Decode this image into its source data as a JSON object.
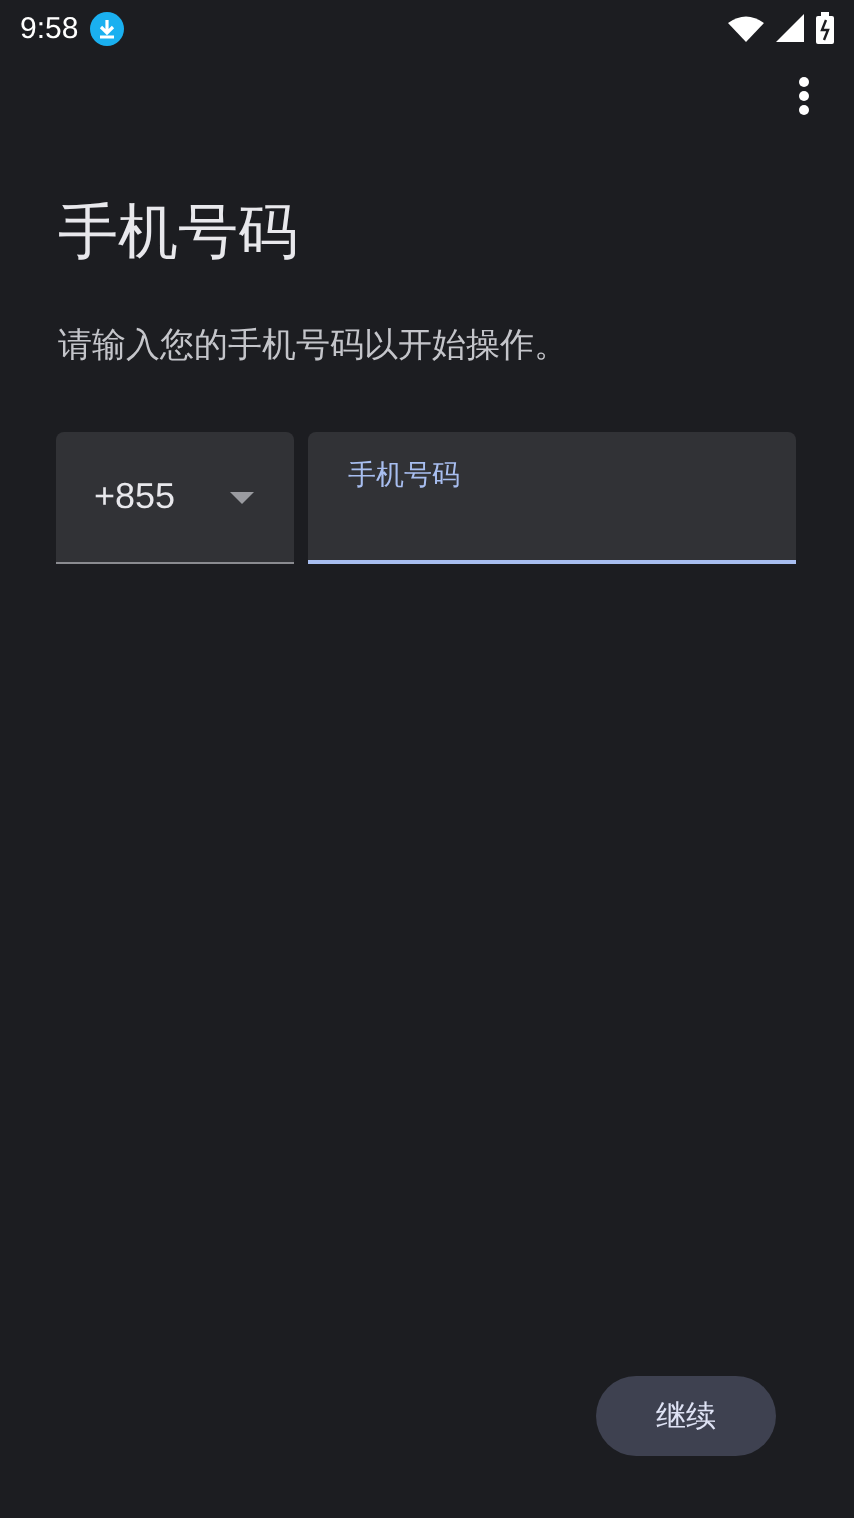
{
  "status_bar": {
    "time": "9:58"
  },
  "title": "手机号码",
  "subtitle": "请输入您的手机号码以开始操作。",
  "country_code": {
    "value": "+855"
  },
  "phone_field": {
    "label": "手机号码",
    "focused": true
  },
  "continue_button": {
    "label": "继续"
  }
}
